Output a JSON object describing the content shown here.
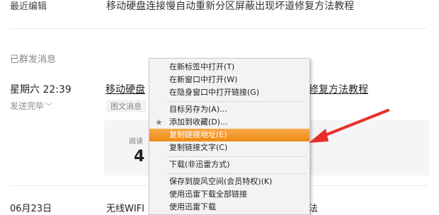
{
  "top": {
    "label": "最近编辑",
    "title": "移动硬盘连接慢自动重新分区屏蔽出现坏道修复方法教程"
  },
  "sent_section": {
    "label": "已群发消息"
  },
  "message": {
    "date": "星期六 22:39",
    "status": "发送完毕",
    "title_left": "移动硬盘",
    "title_right": "修复方法教程",
    "tag": "图文消息",
    "read_label": "阅读",
    "read_count": "4"
  },
  "next_message": {
    "date": "06月23日",
    "title": "无线WIFI",
    "title_right": "法"
  },
  "context_menu": {
    "items": [
      {
        "label": "在新标签中打开(T)"
      },
      {
        "label": "在新窗口中打开(W)"
      },
      {
        "label": "在隐身窗口中打开链接(G)"
      },
      {
        "label": "目标另存为(A)..."
      },
      {
        "label": "添加到收藏(D)...",
        "icon": "star-icon"
      },
      {
        "label": "复制链接地址(E)",
        "highlighted": true
      },
      {
        "label": "复制链接文字(C)"
      },
      {
        "label": "下载(非迅雷方式)"
      },
      {
        "label": "保存到旋风空间(会员特权)(K)"
      },
      {
        "label": "使用迅雷下载全部链接"
      },
      {
        "label": "使用迅雷下载"
      }
    ]
  },
  "colors": {
    "highlight": "#ee8a12",
    "arrow": "#e8302a"
  }
}
